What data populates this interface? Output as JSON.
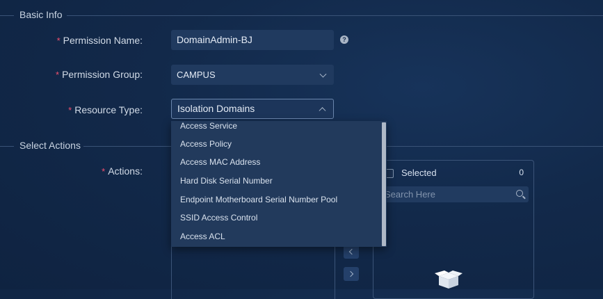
{
  "sections": {
    "basic_info": "Basic Info",
    "select_actions": "Select Actions"
  },
  "form": {
    "permission_name": {
      "label": "Permission Name:",
      "value": "DomainAdmin-BJ"
    },
    "permission_group": {
      "label": "Permission Group:",
      "value": "CAMPUS"
    },
    "resource_type": {
      "label": "Resource Type:",
      "value": "Isolation Domains"
    },
    "actions": {
      "label": "Actions:"
    }
  },
  "required_mark": "*",
  "help_icon": "?",
  "dropdown": {
    "options": [
      "Access Service",
      "Access Policy",
      "Access MAC Address",
      "Hard Disk Serial Number",
      "Endpoint Motherboard Serial Number Pool",
      "SSID Access Control",
      "Access ACL"
    ]
  },
  "selected_panel": {
    "title": "Selected",
    "count": "0",
    "search_placeholder": "Search Here"
  },
  "icons": {
    "help": "question-circle-icon",
    "select_chevron": "chevron-down-icon",
    "search": "search-icon",
    "empty": "empty-box-icon",
    "transfer_left": "chevron-left-icon",
    "transfer_right": "chevron-right-icon"
  }
}
